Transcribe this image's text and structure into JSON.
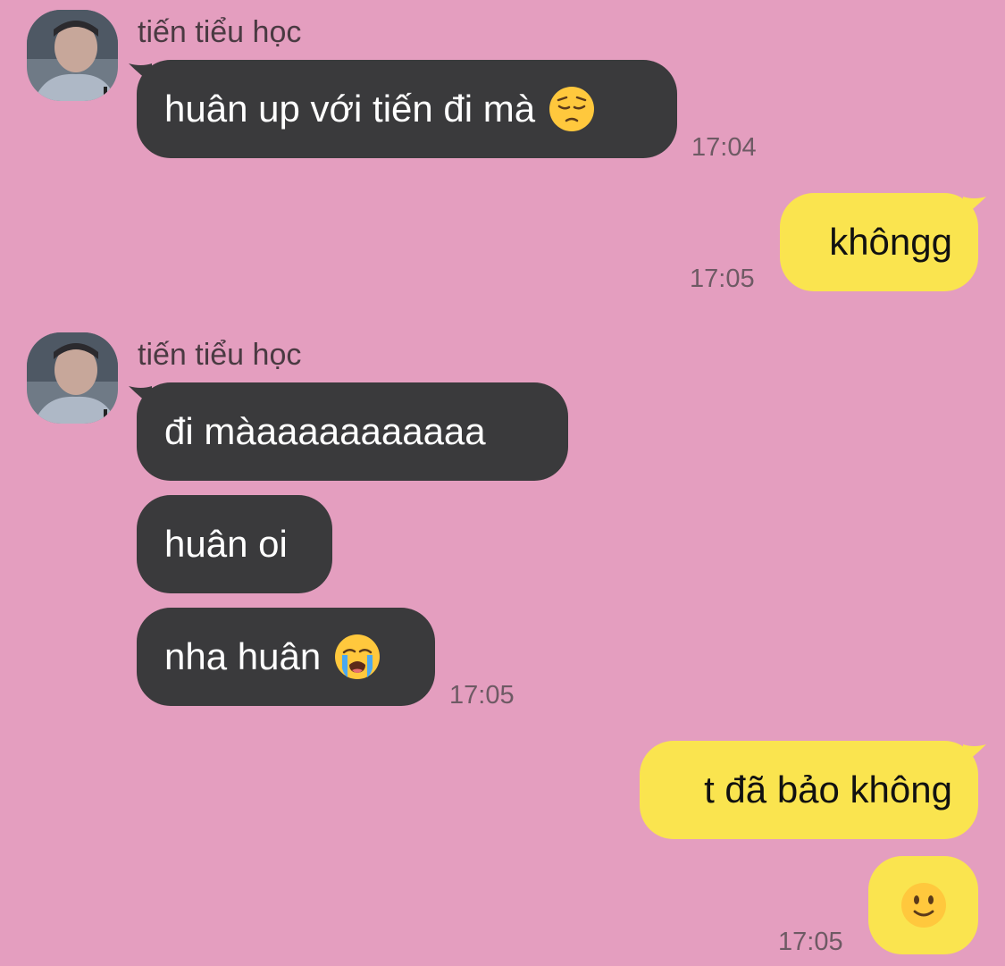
{
  "messages": [
    {
      "sender": "tiến tiểu học",
      "text": "huân up với tiến đi mà",
      "emoji": "pensive-face-emoji",
      "time": "17:04"
    },
    {
      "text": "khôngg",
      "time": "17:05"
    },
    {
      "sender": "tiến tiểu học",
      "texts": [
        "đi màaaaaaaaaaaa",
        "huân oi",
        "nha huân"
      ],
      "emoji": "loudly-crying-face-emoji",
      "time": "17:05"
    },
    {
      "texts": [
        "t đã bảo không",
        ""
      ],
      "emoji": "slightly-smiling-face-emoji",
      "time": "17:05"
    }
  ],
  "colors": {
    "background": "#e49ebf",
    "incoming_bubble": "#3a3a3c",
    "outgoing_bubble": "#fae44f",
    "timestamp": "#6e5a64"
  }
}
